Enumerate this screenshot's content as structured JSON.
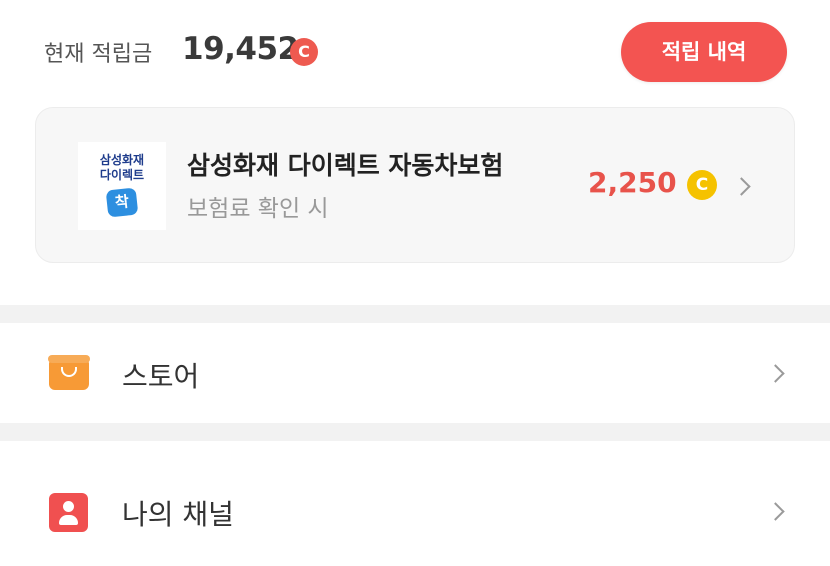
{
  "points": {
    "label": "현재 적립금",
    "value": "19,452",
    "coin_symbol": "C",
    "history_button_label": "적립 내역"
  },
  "offer": {
    "logo": {
      "line1": "삼성화재",
      "line2": "다이렉트",
      "badge": "착"
    },
    "title": "삼성화재 다이렉트 자동차보험",
    "subtitle": "보험료 확인 시",
    "reward": "2,250",
    "coin_symbol": "C"
  },
  "menu": [
    {
      "label": "스토어",
      "icon": "shopping-bag-icon"
    },
    {
      "label": "나의 채널",
      "icon": "person-icon"
    }
  ],
  "colors": {
    "accent_red": "#f35451",
    "reward_red": "#e8534b",
    "coin_yellow": "#f5c200",
    "store_orange": "#f79a36"
  }
}
